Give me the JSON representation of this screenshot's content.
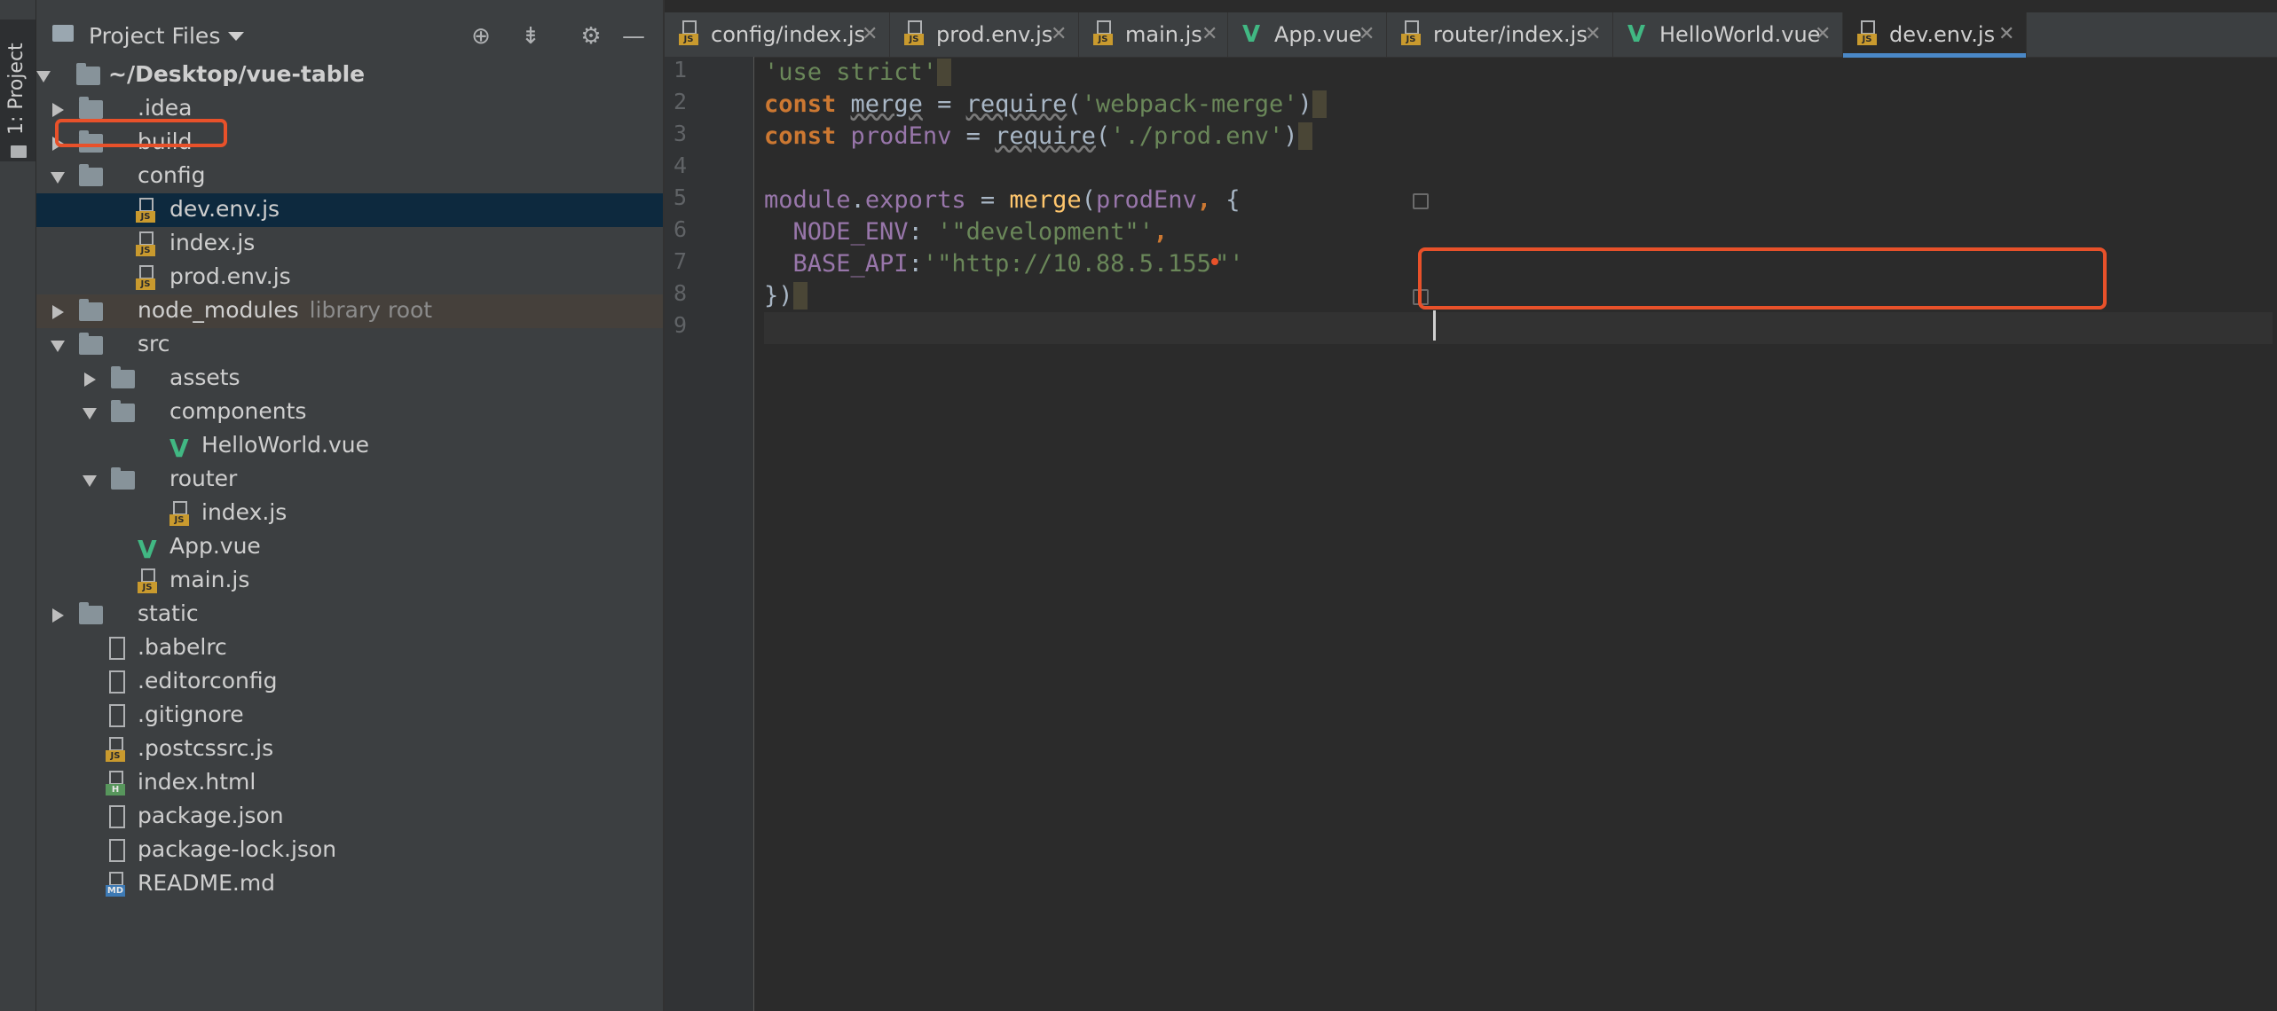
{
  "toolwindow": {
    "label": "1: Project"
  },
  "project": {
    "header": {
      "title": "Project Files"
    },
    "root": "~/Desktop/vue-table",
    "items": [
      {
        "label": ".idea"
      },
      {
        "label": "build"
      },
      {
        "label": "config"
      },
      {
        "label": "dev.env.js"
      },
      {
        "label": "index.js"
      },
      {
        "label": "prod.env.js"
      },
      {
        "label": "node_modules",
        "suffix": "library root"
      },
      {
        "label": "src"
      },
      {
        "label": "assets"
      },
      {
        "label": "components"
      },
      {
        "label": "HelloWorld.vue"
      },
      {
        "label": "router"
      },
      {
        "label": "index.js"
      },
      {
        "label": "App.vue"
      },
      {
        "label": "main.js"
      },
      {
        "label": "static"
      },
      {
        "label": ".babelrc"
      },
      {
        "label": ".editorconfig"
      },
      {
        "label": ".gitignore"
      },
      {
        "label": ".postcssrc.js"
      },
      {
        "label": "index.html"
      },
      {
        "label": "package.json"
      },
      {
        "label": "package-lock.json"
      },
      {
        "label": "README.md"
      }
    ]
  },
  "tabs": [
    {
      "label": "config/index.js"
    },
    {
      "label": "prod.env.js"
    },
    {
      "label": "main.js"
    },
    {
      "label": "App.vue"
    },
    {
      "label": "router/index.js"
    },
    {
      "label": "HelloWorld.vue"
    },
    {
      "label": "dev.env.js",
      "active": true
    }
  ],
  "editor": {
    "line_numbers": [
      "1",
      "2",
      "3",
      "4",
      "5",
      "6",
      "7",
      "8",
      "9"
    ],
    "code": {
      "l1": "'use strict'",
      "l2_kw": "const",
      "l2_id": "merge",
      "l2_eq": " = ",
      "l2_req": "require",
      "l2_str": "'webpack-merge'",
      "l3_kw": "const",
      "l3_id": "prodEnv",
      "l3_eq": " = ",
      "l3_req": "require",
      "l3_str": "'./prod.env'",
      "l5_mod": "module",
      "l5_exp": "exports",
      "l5_merge": "merge",
      "l5_arg": "prodEnv",
      "l6_key": "NODE_ENV",
      "l6_val": "'\"development\"'",
      "l7_key": "BASE_API",
      "l7_val": "'\"http://10.88.5.155",
      "l7_end": "\"'",
      "l8": "})"
    }
  },
  "colors": {
    "annotation": "#e8512a",
    "active_tab_underline": "#4a88c7",
    "selection": "#0d293e"
  }
}
